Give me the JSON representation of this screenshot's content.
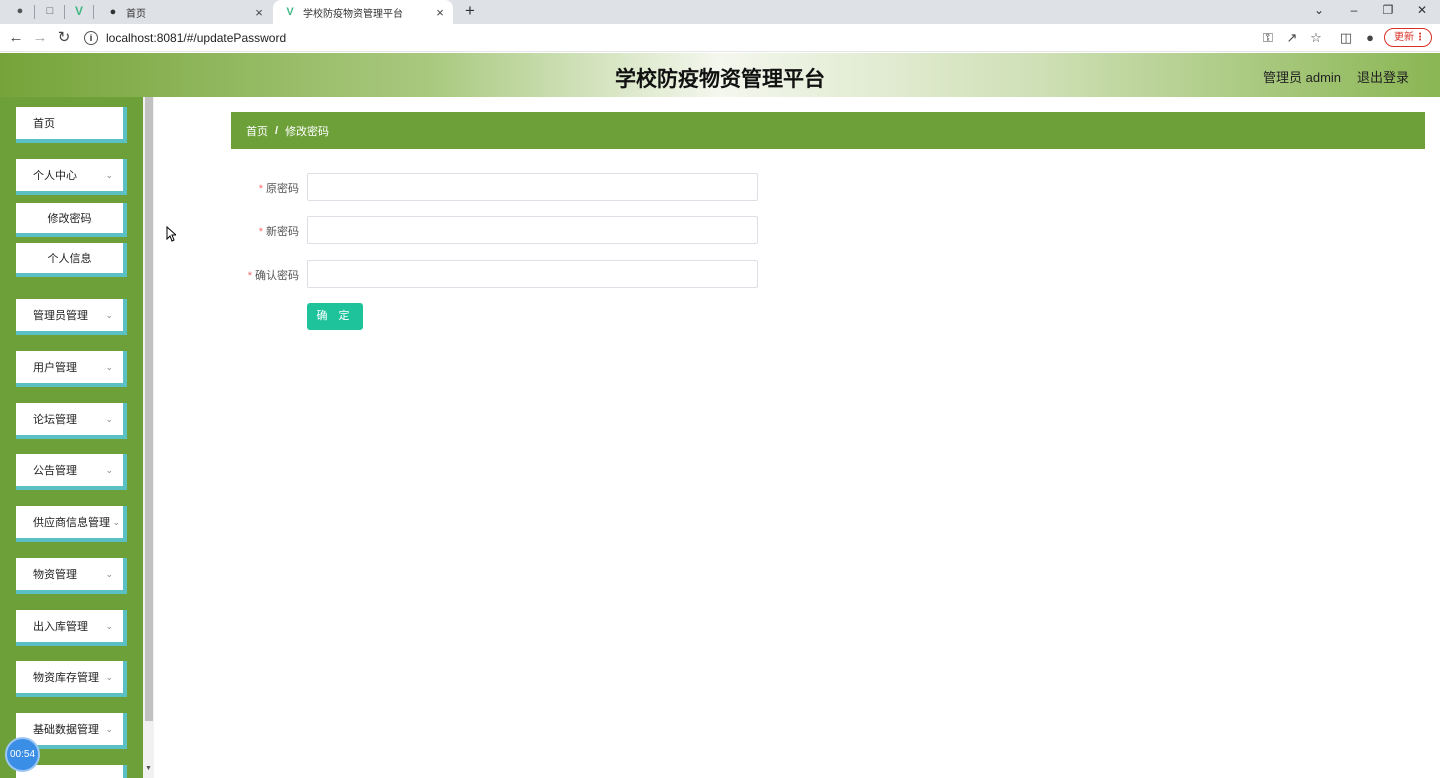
{
  "browser": {
    "tabs": [
      {
        "title": "首页",
        "active": false
      },
      {
        "title": "学校防疫物资管理平台",
        "active": true
      }
    ],
    "url": "localhost:8081/#/updatePassword",
    "update_label": "更新"
  },
  "header": {
    "title": "学校防疫物资管理平台",
    "user_label": "管理员 admin",
    "logout_label": "退出登录"
  },
  "sidebar": {
    "items": [
      {
        "label": "首页",
        "has_children": false
      },
      {
        "label": "个人中心",
        "has_children": true,
        "children": [
          "修改密码",
          "个人信息"
        ]
      },
      {
        "label": "管理员管理",
        "has_children": true
      },
      {
        "label": "用户管理",
        "has_children": true
      },
      {
        "label": "论坛管理",
        "has_children": true
      },
      {
        "label": "公告管理",
        "has_children": true
      },
      {
        "label": "供应商信息管理",
        "has_children": true
      },
      {
        "label": "物资管理",
        "has_children": true
      },
      {
        "label": "出入库管理",
        "has_children": true
      },
      {
        "label": "物资库存管理",
        "has_children": true
      },
      {
        "label": "基础数据管理",
        "has_children": true
      }
    ]
  },
  "breadcrumb": {
    "home": "首页",
    "separator": "/",
    "current": "修改密码"
  },
  "form": {
    "fields": [
      {
        "label": "原密码",
        "required": true,
        "value": ""
      },
      {
        "label": "新密码",
        "required": true,
        "value": ""
      },
      {
        "label": "确认密码",
        "required": true,
        "value": ""
      }
    ],
    "submit_label": "确 定"
  },
  "timer": "00:54",
  "colors": {
    "theme_green": "#6ea03a",
    "menu_border": "#5bc0c4",
    "submit": "#1ec29b"
  }
}
